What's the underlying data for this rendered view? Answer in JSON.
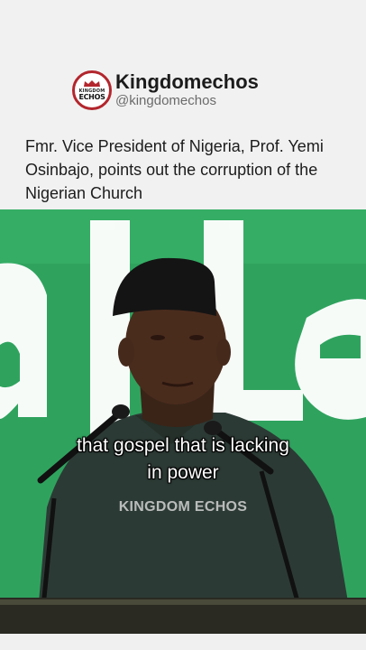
{
  "account": {
    "display_name": "Kingdomechos",
    "handle": "@kingdomechos",
    "logo_text_top": "KINGDOM",
    "logo_text_main": "ECHOS"
  },
  "post": {
    "caption": "Fmr. Vice President of Nigeria, Prof. Yemi Osinbajo, points out the corruption of the Nigerian Church"
  },
  "video": {
    "subtitle_line1": "that gospel that is lacking",
    "subtitle_line2": "in power",
    "watermark": "KINGDOM ECHOS",
    "backdrop_letters": "al Le"
  },
  "colors": {
    "brand_red": "#b3262d",
    "stage_green": "#2fa35e"
  }
}
